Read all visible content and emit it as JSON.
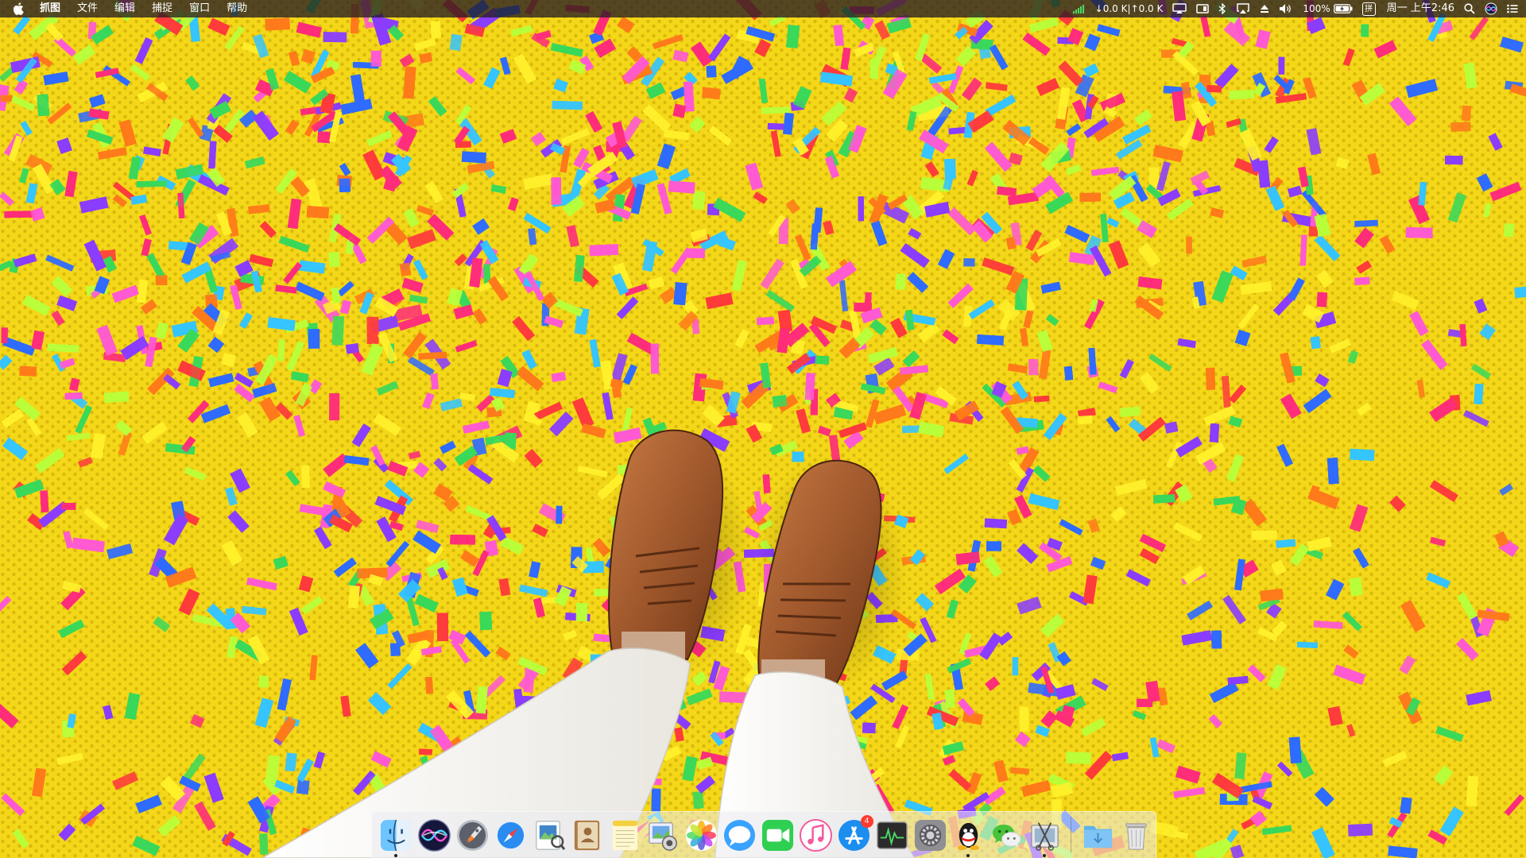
{
  "menubar": {
    "app_name": "抓图",
    "menus": [
      "文件",
      "编辑",
      "捕捉",
      "窗口",
      "帮助"
    ],
    "network_speed": "↓0.0 K|↑0.0 K",
    "battery_percent": "100%",
    "input_method": "拼",
    "clock": "周一 上午2:46"
  },
  "dock": {
    "apps": [
      {
        "icon": "finder-icon"
      },
      {
        "icon": "siri-icon"
      },
      {
        "icon": "launchpad-icon"
      },
      {
        "icon": "safari-icon"
      },
      {
        "icon": "preview-icon"
      },
      {
        "icon": "contacts-icon"
      },
      {
        "icon": "notes-icon"
      },
      {
        "icon": "image-capture-icon"
      },
      {
        "icon": "photos-icon"
      },
      {
        "icon": "messages-icon"
      },
      {
        "icon": "facetime-icon"
      },
      {
        "icon": "itunes-icon"
      },
      {
        "icon": "app-store-icon",
        "badge": "4"
      },
      {
        "icon": "activity-monitor-icon"
      },
      {
        "icon": "system-preferences-icon"
      },
      {
        "icon": "qq-icon"
      },
      {
        "icon": "wechat-icon"
      },
      {
        "icon": "screenshot-app-icon"
      }
    ],
    "folders": [
      {
        "icon": "downloads-folder-icon"
      },
      {
        "icon": "trash-icon"
      }
    ]
  },
  "colors": {
    "wallpaper_base": "#f3d51a",
    "confetti": [
      "#ff2d7a",
      "#2f6bff",
      "#ffef2a",
      "#3ad85a",
      "#ff7a1a",
      "#8a3dff",
      "#ff3b3b",
      "#35c4ff",
      "#b9ff3a",
      "#ff5ad1"
    ],
    "menubar_bg": "#261e22",
    "badge": "#ff3b30"
  }
}
